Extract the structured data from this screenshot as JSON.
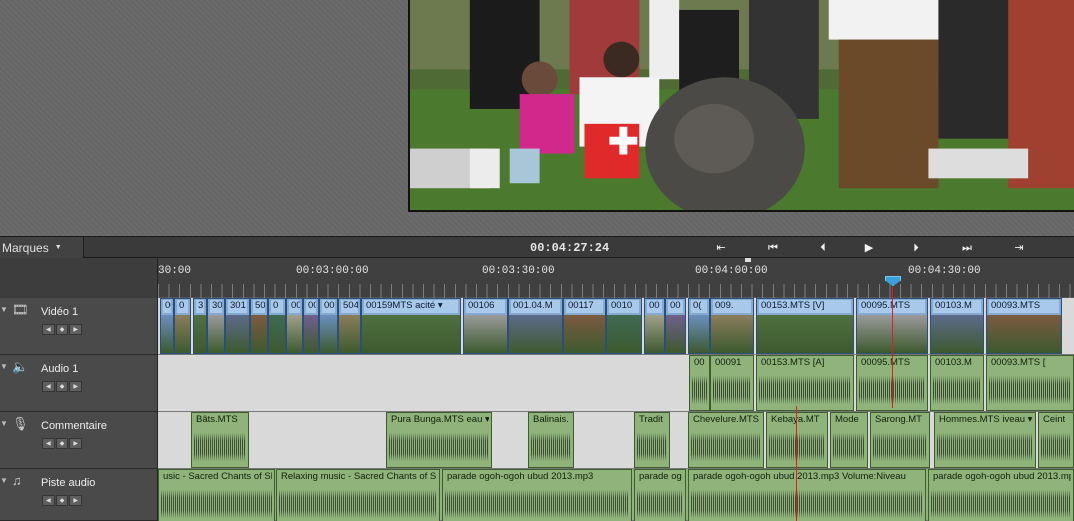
{
  "transport": {
    "markers_label": "Marques",
    "timecode": "00:04:27:24",
    "buttons": [
      "go-to-in",
      "go-to-previous-edit",
      "step-back",
      "play",
      "step-forward",
      "go-to-next-edit",
      "go-to-out"
    ]
  },
  "ruler": {
    "labels": [
      "30:00",
      "00:03:00:00",
      "00:03:30:00",
      "00:04:00:00",
      "00:04:30:00"
    ]
  },
  "tracks": [
    {
      "name": "Vidéo 1",
      "icon": "film-icon"
    },
    {
      "name": "Audio 1",
      "icon": "speaker-icon"
    },
    {
      "name": "Commentaire",
      "icon": "microphone-icon"
    },
    {
      "name": "Piste audio",
      "icon": "music-note-icon"
    }
  ],
  "video_clips": [
    "00",
    "0",
    "3",
    "30",
    "301",
    "50",
    "0",
    "00",
    "00",
    "00",
    "504",
    "00159MTS",
    "00106",
    "001.04.M",
    "00117",
    "0010",
    "00",
    "00",
    "0(",
    "009.",
    "00153.MTS [V]",
    "00095.MTS",
    "00103.M",
    "00093.MTS"
  ],
  "video_clip_extra": "acité",
  "audio1_clips": [
    "00",
    "00091",
    "00153.MTS [A]",
    "00095.MTS",
    "00103.M",
    "00093.MTS ["
  ],
  "commentary_clips": [
    "Bâts.MTS",
    "Pura Bunga.MTS",
    "Balinais.",
    "Tradit",
    "Chevelure.MTS",
    "Kebaya.MT",
    "Mode",
    "Sarong.MT",
    "Hommes.MTS",
    "Ceint"
  ],
  "commentary_extra": [
    "eau",
    "iveau"
  ],
  "music_clips": [
    "usic - Sacred Chants of Sh",
    "Relaxing music - Sacred Chants of S",
    "parade ogoh-ogoh ubud 2013.mp3",
    "parade og",
    "parade ogoh-ogoh ubud 2013.mp3 Volume:Niveau",
    "parade ogoh-ogoh ubud 2013.mp3"
  ],
  "music_extra": [
    "veau",
    "veau"
  ],
  "colors": {
    "video_clip": "#86a9cf",
    "audio_clip": "#8fb37a",
    "playhead": "#3aa0d8",
    "edit_line": "#e02020"
  }
}
